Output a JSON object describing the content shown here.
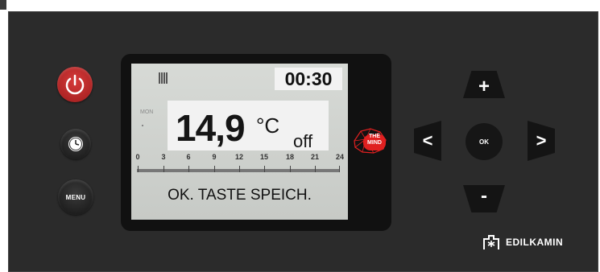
{
  "buttons": {
    "power": "power-icon",
    "clock": "clock-icon",
    "menu_label": "MENU",
    "up_label": "+",
    "down_label": "-",
    "left_label": "<",
    "right_label": ">",
    "ok_label": "OK"
  },
  "display": {
    "time": "00:30",
    "day": "MON",
    "temperature": "14,9",
    "unit": "°C",
    "state": "off",
    "scale_labels": [
      "0",
      "3",
      "6",
      "9",
      "12",
      "15",
      "18",
      "21",
      "24"
    ],
    "message": "OK. TASTE SPEICH."
  },
  "logos": {
    "mind_line1": "THE",
    "mind_line2": "MIND",
    "brand": "EDILKAMIN"
  },
  "colors": {
    "panel": "#2b2b2b",
    "power_button": "#c62828",
    "lcd_background": "#d3d6d2",
    "mind_red": "#e02020"
  }
}
